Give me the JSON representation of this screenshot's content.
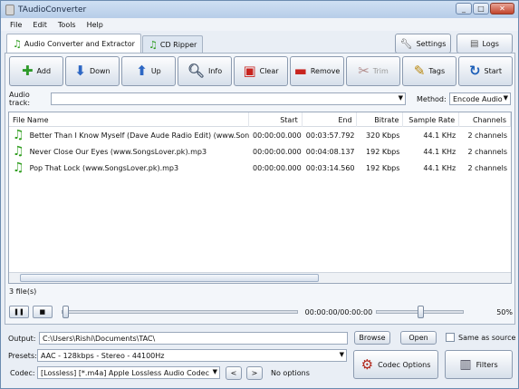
{
  "window": {
    "title": "TAudioConverter",
    "minimize": "_",
    "maximize": "□",
    "close": "✕"
  },
  "menu": [
    "File",
    "Edit",
    "Tools",
    "Help"
  ],
  "tabs": [
    {
      "label": "Audio Converter and Extractor",
      "icon": "music-note-icon"
    },
    {
      "label": "CD Ripper",
      "icon": "music-note-icon"
    }
  ],
  "top_buttons": {
    "settings": "Settings",
    "logs": "Logs"
  },
  "toolbar": [
    {
      "label": "Add",
      "icon": "add-icon",
      "glyph": "✚",
      "color": "#2e9a2a",
      "enabled": true
    },
    {
      "label": "Down",
      "icon": "arrow-down-icon",
      "glyph": "⬇",
      "color": "#2d67c4",
      "enabled": true
    },
    {
      "label": "Up",
      "icon": "arrow-up-icon",
      "glyph": "⬆",
      "color": "#2d67c4",
      "enabled": true
    },
    {
      "label": "Info",
      "icon": "magnifier-icon",
      "glyph": "🔍︎",
      "color": "#4a5a70",
      "enabled": true
    },
    {
      "label": "Clear",
      "icon": "clear-icon",
      "glyph": "▣",
      "color": "#c8231e",
      "enabled": true
    },
    {
      "label": "Remove",
      "icon": "remove-icon",
      "glyph": "▬",
      "color": "#c8231e",
      "enabled": true
    },
    {
      "label": "Trim",
      "icon": "scissors-icon",
      "glyph": "✂",
      "color": "#b28c8c",
      "enabled": false
    },
    {
      "label": "Tags",
      "icon": "pencil-icon",
      "glyph": "✎",
      "color": "#b8860b",
      "enabled": true
    },
    {
      "label": "Start",
      "icon": "start-icon",
      "glyph": "↻",
      "color": "#1d5fb8",
      "enabled": true
    }
  ],
  "track": {
    "label": "Audio track:",
    "value": ""
  },
  "method": {
    "label": "Method:",
    "value": "Encode Audio"
  },
  "columns": [
    "File Name",
    "Start",
    "End",
    "Bitrate",
    "Sample Rate",
    "Channels"
  ],
  "rows": [
    {
      "name": "Better Than I Know Myself (Dave Aude Radio Edit) (www.SongsL...",
      "start": "00:00:00.000",
      "end": "00:03:57.792",
      "bitrate": "320 Kbps",
      "sample_rate": "44.1 KHz",
      "channels": "2 channels"
    },
    {
      "name": "Never Close Our Eyes (www.SongsLover.pk).mp3",
      "start": "00:00:00.000",
      "end": "00:04:08.137",
      "bitrate": "192 Kbps",
      "sample_rate": "44.1 KHz",
      "channels": "2 channels"
    },
    {
      "name": "Pop That Lock (www.SongsLover.pk).mp3",
      "start": "00:00:00.000",
      "end": "00:03:14.560",
      "bitrate": "192 Kbps",
      "sample_rate": "44.1 KHz",
      "channels": "2 channels"
    }
  ],
  "file_count": "3 file(s)",
  "player": {
    "time": "00:00:00/00:00:00",
    "volume": "50%",
    "position": 0,
    "volume_level": 0.5
  },
  "output": {
    "label": "Output:",
    "value": "C:\\Users\\Rishi\\Documents\\TAC\\",
    "browse": "Browse",
    "open": "Open",
    "same_as_source": "Same as source"
  },
  "presets": {
    "label": "Presets:",
    "value": "AAC - 128kbps - Stereo - 44100Hz"
  },
  "codec": {
    "label": "Codec:",
    "value": "[Lossless] [*.m4a] Apple Lossless Audio Codec",
    "prev": "<",
    "next": ">",
    "options": "No options"
  },
  "buttons": {
    "codec_options": "Codec Options",
    "filters": "Filters"
  },
  "colors": {
    "accent": "#2d67c4",
    "note": "#2d9c1c"
  }
}
